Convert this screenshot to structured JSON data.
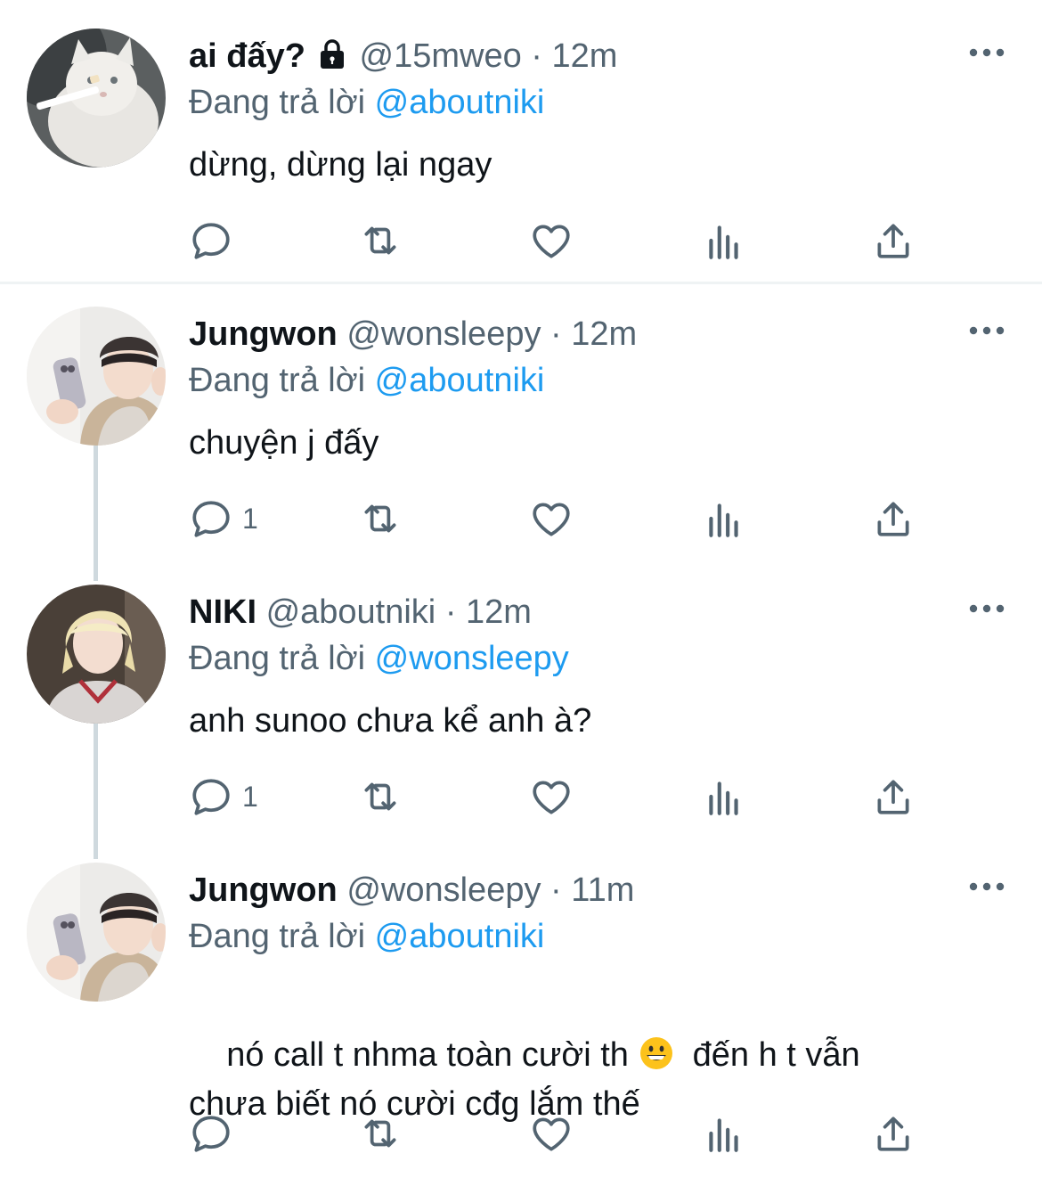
{
  "tweets": [
    {
      "name": "ai đấy?",
      "handle": "@15mweo",
      "sep": "·",
      "time": "12m",
      "replying_prefix": "Đang trả lời",
      "replying_to": "@aboutniki",
      "text": "dừng, dừng lại ngay",
      "reply_count": "",
      "locked": true,
      "avatar": "white-cat-avatar"
    },
    {
      "name": "Jungwon",
      "handle": "@wonsleepy",
      "sep": "·",
      "time": "12m",
      "replying_prefix": "Đang trả lời",
      "replying_to": "@aboutniki",
      "text": "chuyện j đấy",
      "reply_count": "1",
      "avatar": "jungwon-avatar"
    },
    {
      "name": "NIKI",
      "handle": "@aboutniki",
      "sep": "·",
      "time": "12m",
      "replying_prefix": "Đang trả lời",
      "replying_to": "@wonsleepy",
      "text": "anh sunoo chưa kể anh à?",
      "reply_count": "1",
      "avatar": "niki-avatar"
    },
    {
      "name": "Jungwon",
      "handle": "@wonsleepy",
      "sep": "·",
      "time": "11m",
      "replying_prefix": "Đang trả lời",
      "replying_to": "@aboutniki",
      "text_line1_before_emoji": "nó call t nhma toàn cười th ",
      "text_line1_after_emoji": "  đến h t vẫn",
      "text_line2": "chưa biết nó cười cđg lắm thế",
      "emoji": "grinning-face-emoji",
      "reply_count": "",
      "avatar": "jungwon-avatar"
    }
  ],
  "colors": {
    "text": "#0f1419",
    "secondary": "#536471",
    "link": "#1d9bf0",
    "thread_line": "#cfd9de",
    "divider": "#eff3f4"
  },
  "icons": {
    "reply": "reply-icon",
    "retweet": "retweet-icon",
    "like": "like-icon",
    "views": "views-icon",
    "share": "share-icon",
    "more": "more-icon",
    "lock": "lock-icon"
  }
}
